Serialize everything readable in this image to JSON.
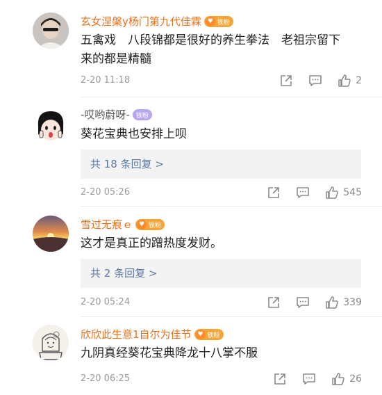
{
  "comments": [
    {
      "username": "玄女涅槃y杨门第九代佳霖",
      "name_color": "#e8711a",
      "badge_label": "铁粉",
      "text_lines": [
        "五禽戏　八段锦都是很好的养生拳法　老祖宗留下",
        "来的都是精髓"
      ],
      "time": "2-20 11:18",
      "likes": "2"
    },
    {
      "username": "-哎哟蔚呀-",
      "name_color": "#555555",
      "badge_label": "铁粉",
      "text_lines": [
        "葵花宝典也安排上呗"
      ],
      "replies": "共 18 条回复 >",
      "time": "2-20 05:26",
      "likes": "545"
    },
    {
      "username": "雪过无痕ｅ",
      "name_color": "#e8711a",
      "badge_label": "铁粉",
      "text_lines": [
        "这才是真正的蹭热度发财。"
      ],
      "replies": "共 2 条回复 >",
      "time": "2-20 05:24",
      "likes": "339"
    },
    {
      "username": "欣欣此生意1自尔为佳节",
      "name_color": "#e8711a",
      "badge_label": "铁粉",
      "text_lines": [
        "九阴真经葵花宝典降龙十八掌不服"
      ],
      "time": "2-20 06:25",
      "likes": "26"
    }
  ],
  "icons": {
    "share": "share-icon",
    "comment": "comment-icon",
    "like": "thumbs-up-icon"
  }
}
